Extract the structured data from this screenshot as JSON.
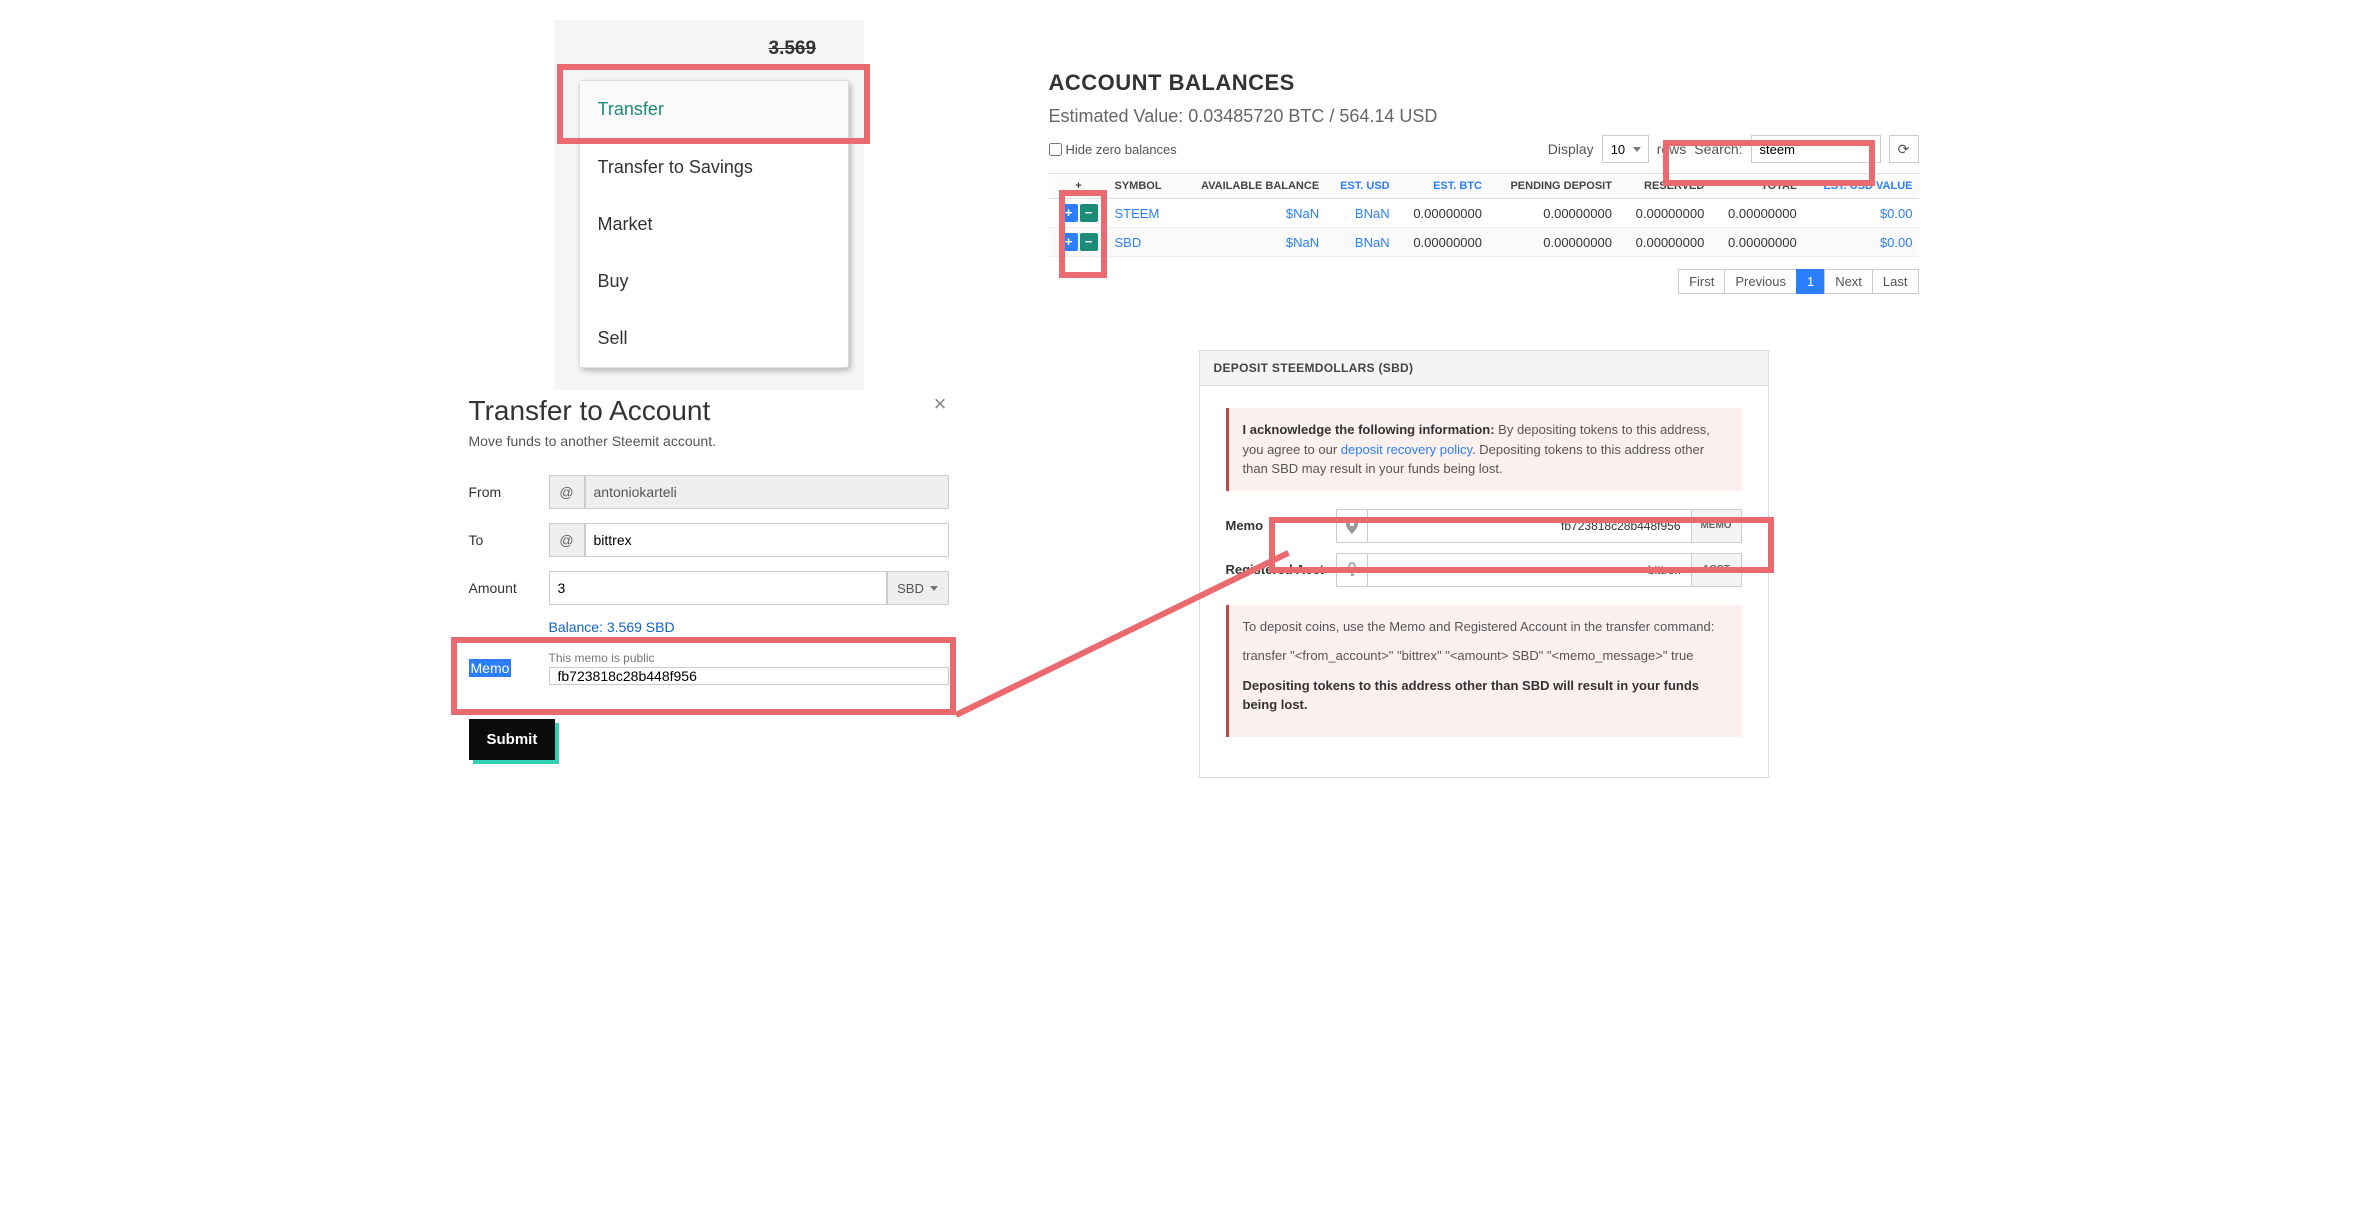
{
  "menu": {
    "price_behind": "3.569",
    "items": [
      "Transfer",
      "Transfer to Savings",
      "Market",
      "Buy",
      "Sell"
    ]
  },
  "transfer": {
    "title": "Transfer to Account",
    "subtitle": "Move funds to another Steemit account.",
    "close_symbol": "×",
    "labels": {
      "from": "From",
      "to": "To",
      "amount": "Amount",
      "memo": "Memo"
    },
    "at": "@",
    "from_value": "antoniokarteli",
    "to_value": "bittrex",
    "amount_value": "3",
    "amount_unit": "SBD",
    "balance_text": "Balance: 3.569 SBD",
    "memo_public": "This memo is public",
    "memo_value": "fb723818c28b448f956",
    "submit": "Submit"
  },
  "balances": {
    "title": "ACCOUNT BALANCES",
    "estimated": "Estimated Value: 0.03485720 BTC / 564.14 USD",
    "hide_zero": "Hide zero balances",
    "display_label": "Display",
    "display_value": "10",
    "rows_label": "rows",
    "search_label": "Search:",
    "search_value": "steem",
    "refresh_glyph": "⟳",
    "headers": {
      "plus": "+",
      "symbol": "SYMBOL",
      "avail": "AVAILABLE BALANCE",
      "usd": "EST. USD",
      "btc": "EST. BTC",
      "pending": "PENDING DEPOSIT",
      "reserved": "RESERVED",
      "total": "TOTAL",
      "usd_val": "EST. USD VALUE"
    },
    "rows": [
      {
        "symbol": "STEEM",
        "avail": "$NaN",
        "usd": "BNaN",
        "btc": "0.00000000",
        "pending": "0.00000000",
        "reserved": "0.00000000",
        "total": "0.00000000",
        "usd_val": "$0.00"
      },
      {
        "symbol": "SBD",
        "avail": "$NaN",
        "usd": "BNaN",
        "btc": "0.00000000",
        "pending": "0.00000000",
        "reserved": "0.00000000",
        "total": "0.00000000",
        "usd_val": "$0.00"
      }
    ],
    "pager": {
      "first": "First",
      "prev": "Previous",
      "page": "1",
      "next": "Next",
      "last": "Last"
    }
  },
  "deposit": {
    "header": "DEPOSIT STEEMDOLLARS (SBD)",
    "ack_strong": "I acknowledge the following information:",
    "ack_text_1": " By depositing tokens to this address, you agree to our ",
    "ack_link": "deposit recovery policy",
    "ack_text_2": ". Depositing tokens to this address other than SBD may result in your funds being lost.",
    "memo_label": "Memo",
    "memo_value": "fb723818c28b448f956",
    "memo_tag": "MEMO",
    "acct_label": "Registered Acct",
    "acct_value": "bittrex",
    "acct_tag": "ACCT",
    "instr1": "To deposit coins, use the Memo and Registered Account in the transfer command:",
    "instr2": "transfer \"<from_account>\" \"bittrex\" \"<amount> SBD\" \"<memo_message>\" true",
    "instr3": "Depositing tokens to this address other than SBD will result in your funds being lost.",
    "pin_glyph": "📍",
    "key_glyph": "🔑"
  }
}
